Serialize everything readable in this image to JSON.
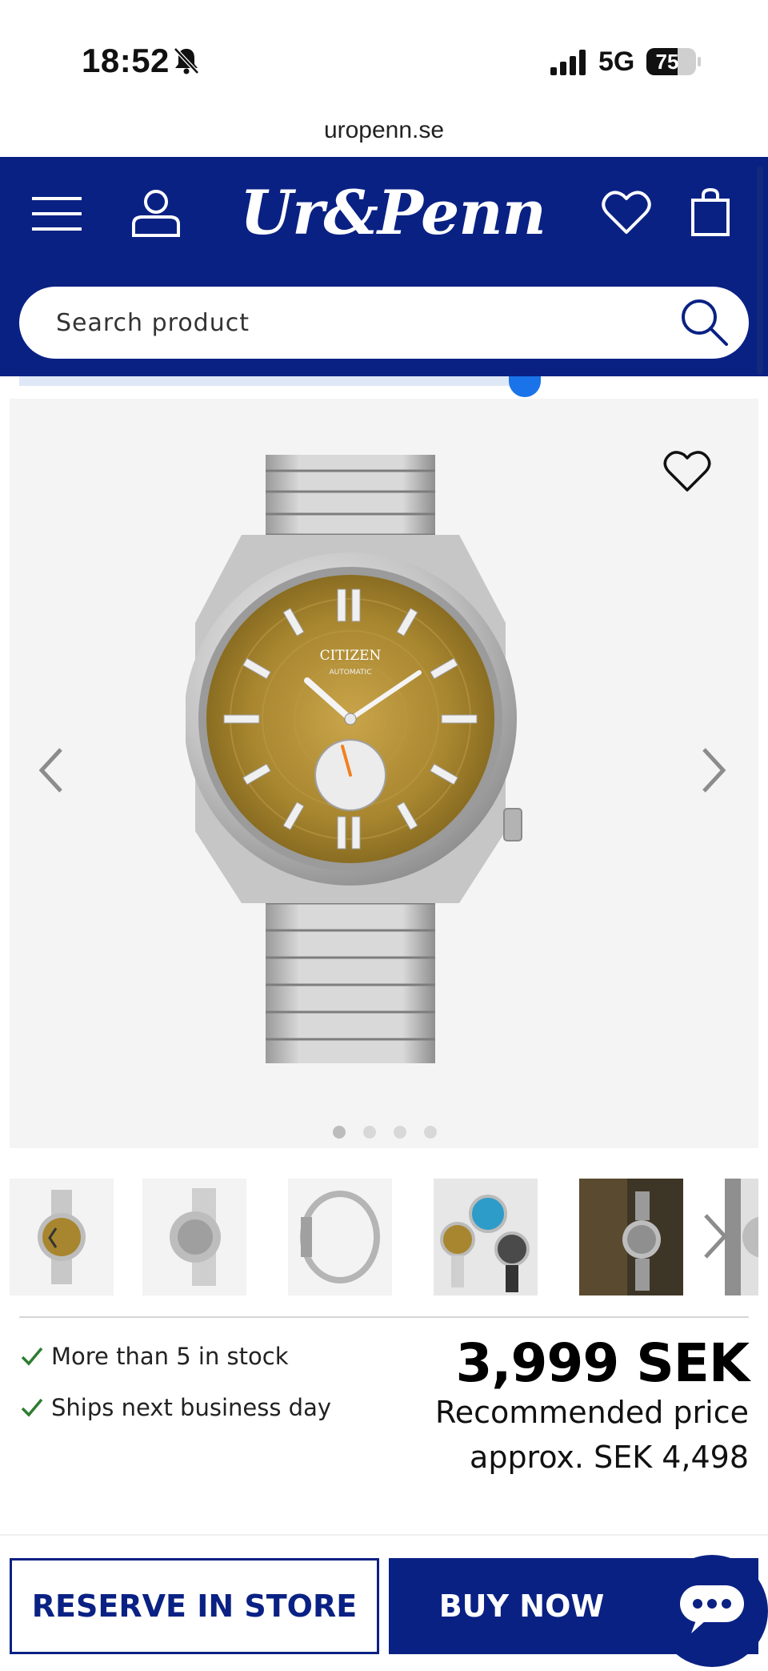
{
  "status_bar": {
    "time": "18:52",
    "network": "5G",
    "battery_level": "75",
    "battery_fraction": 0.75,
    "icons": [
      "bell-slash-icon",
      "signal-icon",
      "battery-icon"
    ]
  },
  "browser": {
    "url": "uropenn.se"
  },
  "header": {
    "logo": "Ur&Penn",
    "background_color": "#0a2184",
    "icons": [
      "menu-icon",
      "account-icon",
      "heart-icon",
      "bag-icon"
    ]
  },
  "search": {
    "placeholder": "Search product"
  },
  "gallery": {
    "image_count": 4,
    "active_index": 0,
    "dial_brand": "CITIZEN",
    "dial_text": "AUTOMATIC",
    "thumbnail_count": 6
  },
  "stock": {
    "items": [
      {
        "label": "More than 5 in stock"
      },
      {
        "label": "Ships next business day"
      }
    ],
    "check_color": "#2e7d32"
  },
  "pricing": {
    "price": "3,999 SEK",
    "recommended_line1": "Recommended price",
    "recommended_line2": "approx. SEK 4,498"
  },
  "actions": {
    "reserve_label": "RESERVE IN STORE",
    "buy_label": "BUY NOW",
    "brand_color": "#0a2184"
  }
}
